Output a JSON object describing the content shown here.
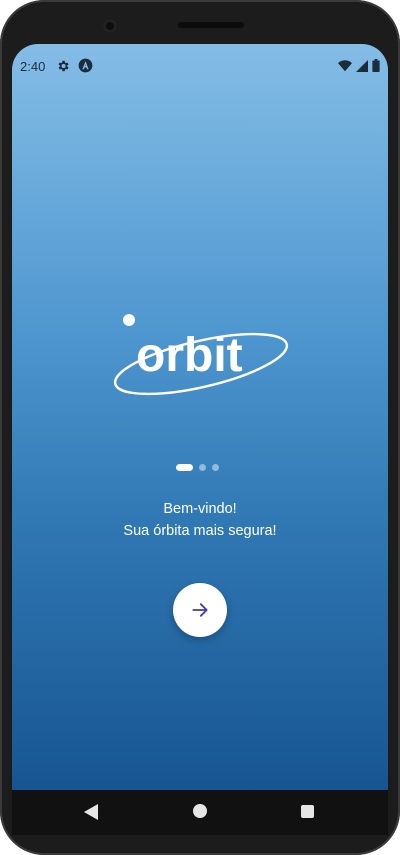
{
  "status_bar": {
    "time": "2:40",
    "icons": [
      "gear-icon",
      "accessibility-icon",
      "wifi-icon",
      "signal-icon",
      "battery-icon"
    ]
  },
  "logo": {
    "text": "orbit"
  },
  "pager": {
    "count": 3,
    "active_index": 0
  },
  "welcome": {
    "line1": "Bem-vindo!",
    "line2": "Sua órbita mais segura!"
  },
  "next_button": {
    "icon": "arrow-right-icon",
    "icon_color": "#3f3fa8"
  },
  "nav_bar": {
    "icons": [
      "back-icon",
      "home-icon",
      "recents-icon"
    ]
  },
  "colors": {
    "gradient_top": "#84bde6",
    "gradient_bottom": "#175592",
    "text": "#ffffff"
  }
}
